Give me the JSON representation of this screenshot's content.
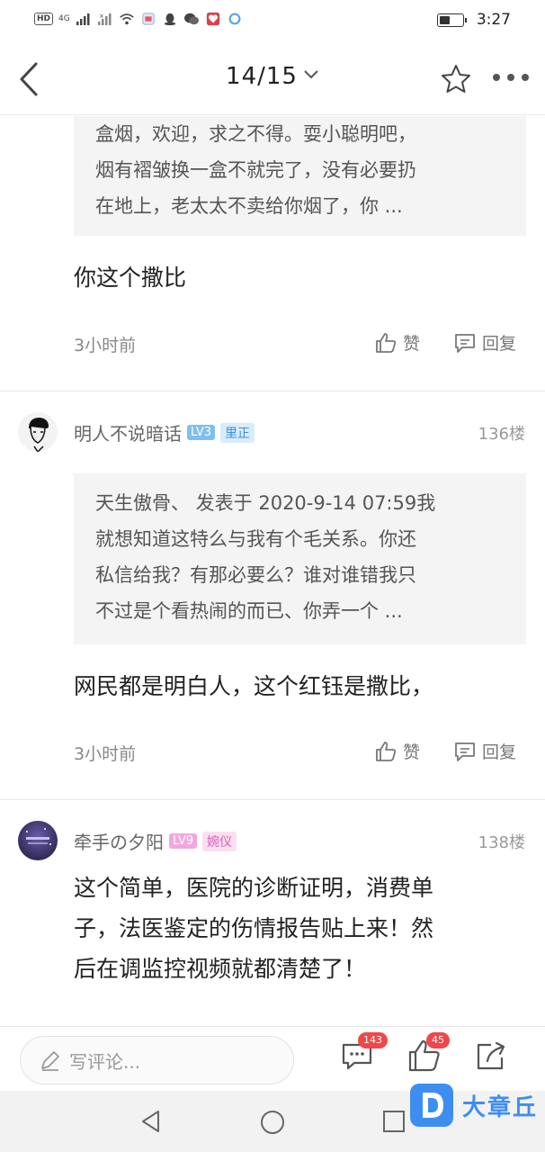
{
  "status_bar": {
    "hd": "HD",
    "signal_4g": "4G",
    "time": "3:27",
    "battery_level": 0.45
  },
  "header": {
    "page_indicator": "14/15"
  },
  "comments": [
    {
      "quote": [
        "盒烟，欢迎，求之不得。耍小聪明吧，",
        "烟有褶皱换一盒不就完了，没有必要扔",
        "在地上，老太太不卖给你烟了，你 ..."
      ],
      "text": [
        "你这个撒比"
      ],
      "time": "3小时前",
      "like_label": "赞",
      "reply_label": "回复"
    },
    {
      "username": "明人不说暗话",
      "level": "LV3",
      "title_badge": "里正",
      "floor": "136楼",
      "quote": [
        "天生傲骨、 发表于 2020-9-14 07:59我",
        "就想知道这特么与我有个毛关系。你还",
        "私信给我？有那必要么？谁对谁错我只",
        "不过是个看热闹的而已、你弄一个 ..."
      ],
      "text": [
        "网民都是明白人，这个红钰是撒比，"
      ],
      "time": "3小时前",
      "like_label": "赞",
      "reply_label": "回复"
    },
    {
      "username": "牵手の夕阳",
      "level": "LV9",
      "title_badge": "婉仪",
      "floor": "138楼",
      "text": [
        "这个简单，医院的诊断证明，消费单",
        "子，法医鉴定的伤情报告贴上来！然",
        "后在调监控视频就都清楚了！"
      ]
    }
  ],
  "bottom_bar": {
    "comment_placeholder": "写评论...",
    "comment_count": "143",
    "like_count": "45"
  },
  "watermark": {
    "logo_letter": "D",
    "text": "大章丘"
  },
  "colors": {
    "lv3": "#7fbfef",
    "lv9": "#f3a7e0",
    "badge_blue_bg": "#d9ecfb",
    "badge_blue_fg": "#3a8fd8",
    "badge_pink_bg": "#fbdff1",
    "badge_pink_fg": "#d85fb6",
    "count_red": "#f0474b",
    "brand_blue": "#3d8ef0"
  }
}
